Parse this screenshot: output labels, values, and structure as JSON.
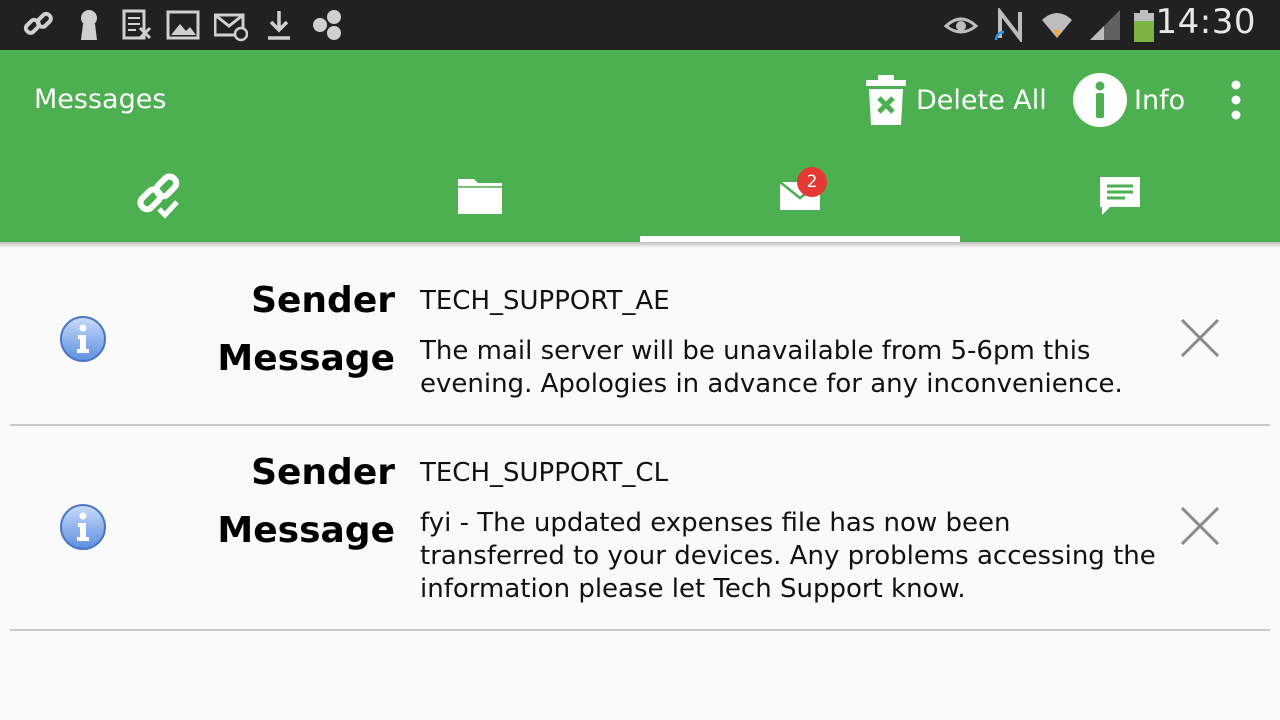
{
  "status_bar": {
    "time": "14:30",
    "left_icons": [
      "link-icon",
      "keyhole-icon",
      "document-icon",
      "image-icon",
      "mail-at-icon",
      "download-icon",
      "hexagons-icon"
    ],
    "right_icons": [
      "eye-icon",
      "nfc-icon",
      "wifi-icon",
      "signal-icon",
      "battery-icon"
    ]
  },
  "action_bar": {
    "title": "Messages",
    "delete_all_label": "Delete All",
    "info_label": "Info"
  },
  "tabs": [
    {
      "icon": "link-check-icon"
    },
    {
      "icon": "folder-icon"
    },
    {
      "icon": "mail-icon",
      "badge": "2",
      "selected": true
    },
    {
      "icon": "chat-icon"
    }
  ],
  "labels": {
    "sender": "Sender",
    "message": "Message"
  },
  "messages": [
    {
      "sender": "TECH_SUPPORT_AE",
      "message": "The mail server will be unavailable from 5-6pm this evening. Apologies in advance for any inconvenience."
    },
    {
      "sender": "TECH_SUPPORT_CL",
      "message": "fyi - The updated expenses file has now been transferred to your devices. Any problems accessing the information please let Tech Support know."
    }
  ],
  "colors": {
    "accent": "#4caf50",
    "status_bar": "#212121",
    "badge": "#e53935"
  }
}
